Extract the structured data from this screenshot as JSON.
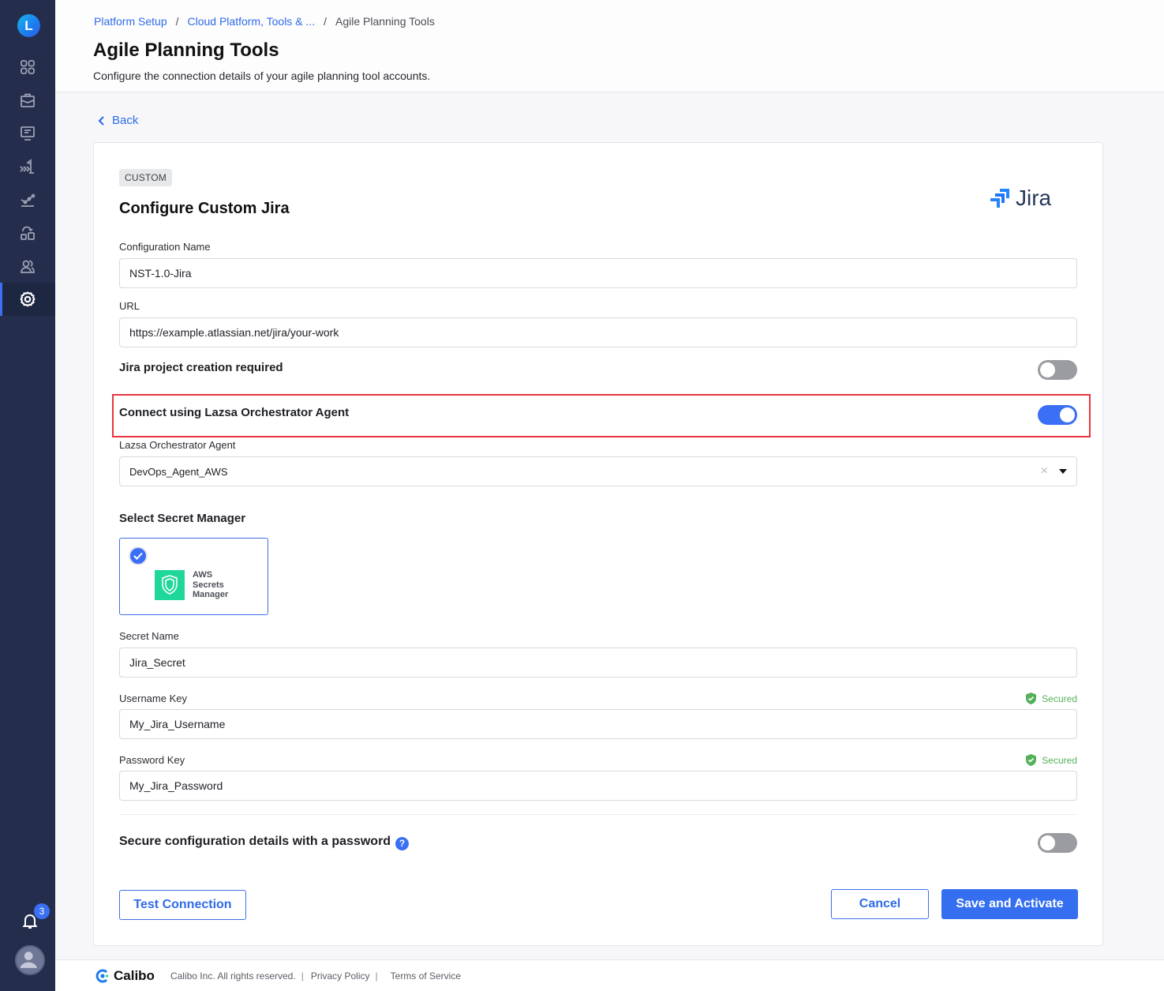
{
  "sidebar": {
    "logo_letter": "L",
    "items": [
      {
        "name": "dashboard",
        "icon": "grid-icon"
      },
      {
        "name": "products",
        "icon": "briefcase-icon"
      },
      {
        "name": "monitor",
        "icon": "monitor-icon"
      },
      {
        "name": "releases",
        "icon": "flag-arrows-icon"
      },
      {
        "name": "insights",
        "icon": "line-chart-icon"
      },
      {
        "name": "integrations",
        "icon": "shapes-refresh-icon"
      },
      {
        "name": "users",
        "icon": "users-icon"
      },
      {
        "name": "settings",
        "icon": "gear-icon",
        "active": true
      }
    ],
    "notifications_count": "3"
  },
  "header": {
    "breadcrumb": [
      {
        "label": "Platform Setup",
        "link": true
      },
      {
        "label": "Cloud Platform, Tools & ...",
        "link": true
      },
      {
        "label": "Agile Planning Tools",
        "link": false
      }
    ],
    "title": "Agile Planning Tools",
    "subtitle": "Configure the connection details of your agile planning tool accounts."
  },
  "back_label": "Back",
  "form": {
    "tag": "CUSTOM",
    "title": "Configure Custom Jira",
    "tool_logo_text": "Jira",
    "config_name": {
      "label": "Configuration Name",
      "value": "NST-1.0-Jira"
    },
    "url": {
      "label": "URL",
      "value": "https://example.atlassian.net/jira/your-work"
    },
    "project_creation": {
      "label": "Jira project creation required",
      "enabled": false
    },
    "connect_agent": {
      "label": "Connect using Lazsa Orchestrator Agent",
      "enabled": true
    },
    "agent": {
      "label": "Lazsa Orchestrator Agent",
      "value": "DevOps_Agent_AWS",
      "clear_icon": "×"
    },
    "secret_manager": {
      "label": "Select Secret Manager",
      "selected": "AWS Secrets Manager",
      "options": [
        {
          "name": "AWS Secrets Manager",
          "lines": [
            "AWS",
            "Secrets",
            "Manager"
          ],
          "selected": true
        }
      ]
    },
    "secret_name": {
      "label": "Secret Name",
      "value": "Jira_Secret"
    },
    "username_key": {
      "label": "Username Key",
      "value": "My_Jira_Username",
      "status": "Secured"
    },
    "password_key": {
      "label": "Password Key",
      "value": "My_Jira_Password",
      "status": "Secured"
    },
    "secure_password": {
      "label": "Secure configuration details with a password",
      "help": "?",
      "enabled": false
    },
    "buttons": {
      "test_connection": "Test Connection",
      "cancel": "Cancel",
      "save": "Save and Activate"
    }
  },
  "footer": {
    "brand": "Calibo",
    "copyright": "Calibo Inc. All rights reserved.",
    "privacy": "Privacy Policy",
    "terms": "Terms of Service"
  },
  "colors": {
    "sidebar_bg": "#242e4c",
    "accent": "#356ff0",
    "highlight": "#e8353e",
    "secured": "#55b05a",
    "aws_green": "#1fd79a"
  }
}
